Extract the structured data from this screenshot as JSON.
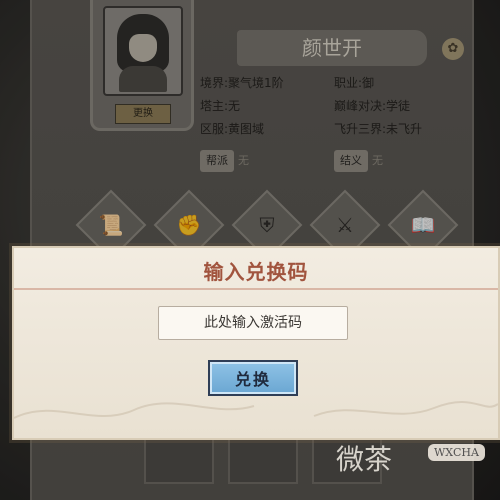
{
  "character": {
    "name": "颜世开",
    "change_label": "更换",
    "realm": "境界:聚气境1阶",
    "profession": "职业:御",
    "tower_master": "塔主:无",
    "arena": "巅峰对决:学徒",
    "region": "区服:黄图域",
    "ascension": "飞升三界:未飞升",
    "sect_label": "帮派",
    "sect_value": "无",
    "oath_label": "结义",
    "oath_value": "无"
  },
  "equipment": {
    "icons": [
      "scroll-icon",
      "fist-icon",
      "armor-icon",
      "sword-icon",
      "book-icon"
    ]
  },
  "dialog": {
    "title": "输入兑换码",
    "input_placeholder": "此处输入激活码",
    "redeem_button_label": "兑换"
  },
  "watermark": {
    "text": "微茶",
    "badge": "WXCHA"
  }
}
